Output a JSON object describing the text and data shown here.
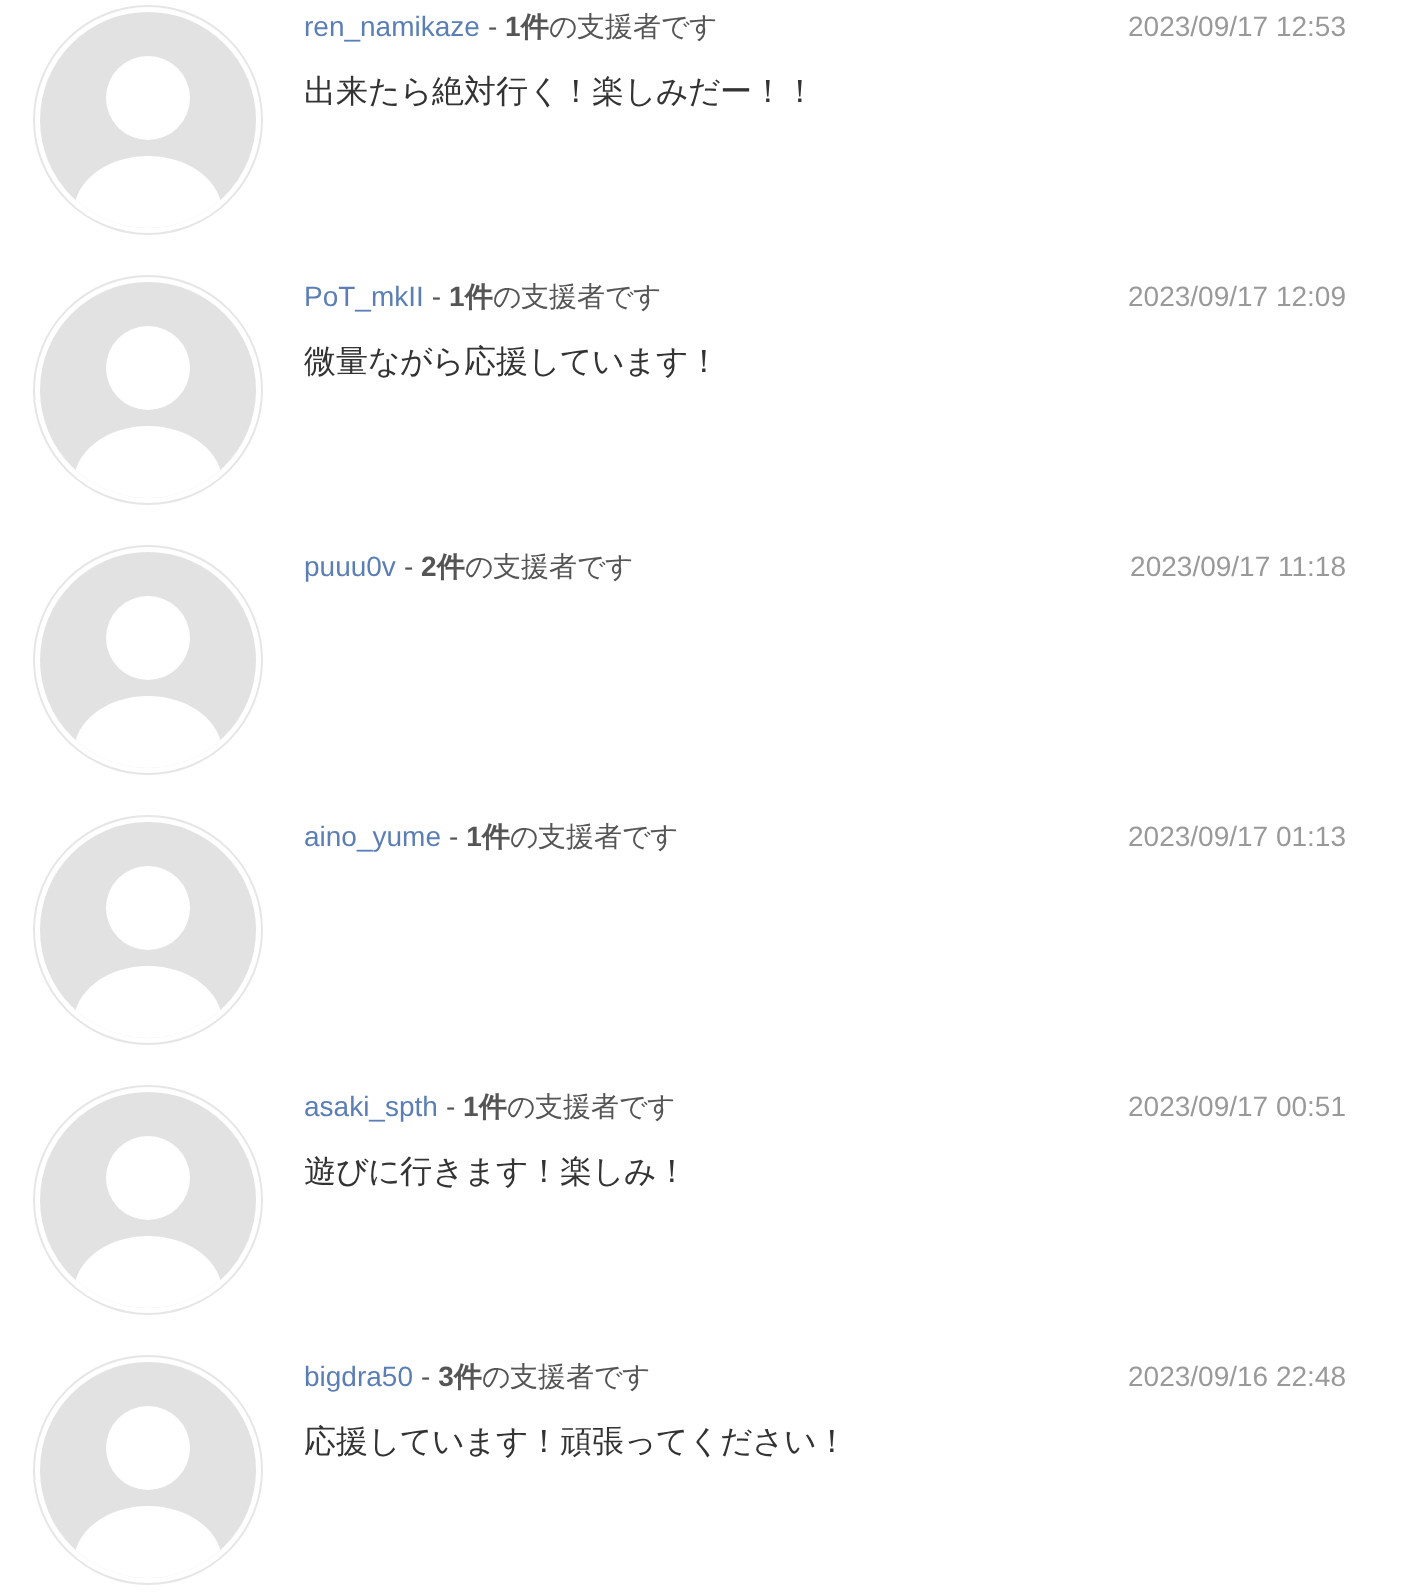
{
  "comments": [
    {
      "user": "ren_namikaze",
      "support": "- **1件**の支援者です",
      "time": "2023/09/17 12:53",
      "text": "出来たら絶対行く！楽しみだー！！"
    },
    {
      "user": "PoT_mkII",
      "support": "- **1件**の支援者です",
      "time": "2023/09/17 12:09",
      "text": "微量ながら応援しています！"
    },
    {
      "user": "puuu0v",
      "support": "- **2件**の支援者です",
      "time": "2023/09/17 11:18"
    },
    {
      "user": "aino_yume",
      "support": "- **1件**の支援者です",
      "time": "2023/09/17 01:13"
    },
    {
      "user": "asaki_spth",
      "support": "- **1件**の支援者です",
      "time": "2023/09/17 00:51",
      "text": "遊びに行きます！楽しみ！"
    },
    {
      "user": "bigdra50",
      "support": "- **3件**の支援者です",
      "time": "2023/09/16 22:48",
      "text": "応援しています！頑張ってください！"
    }
  ]
}
